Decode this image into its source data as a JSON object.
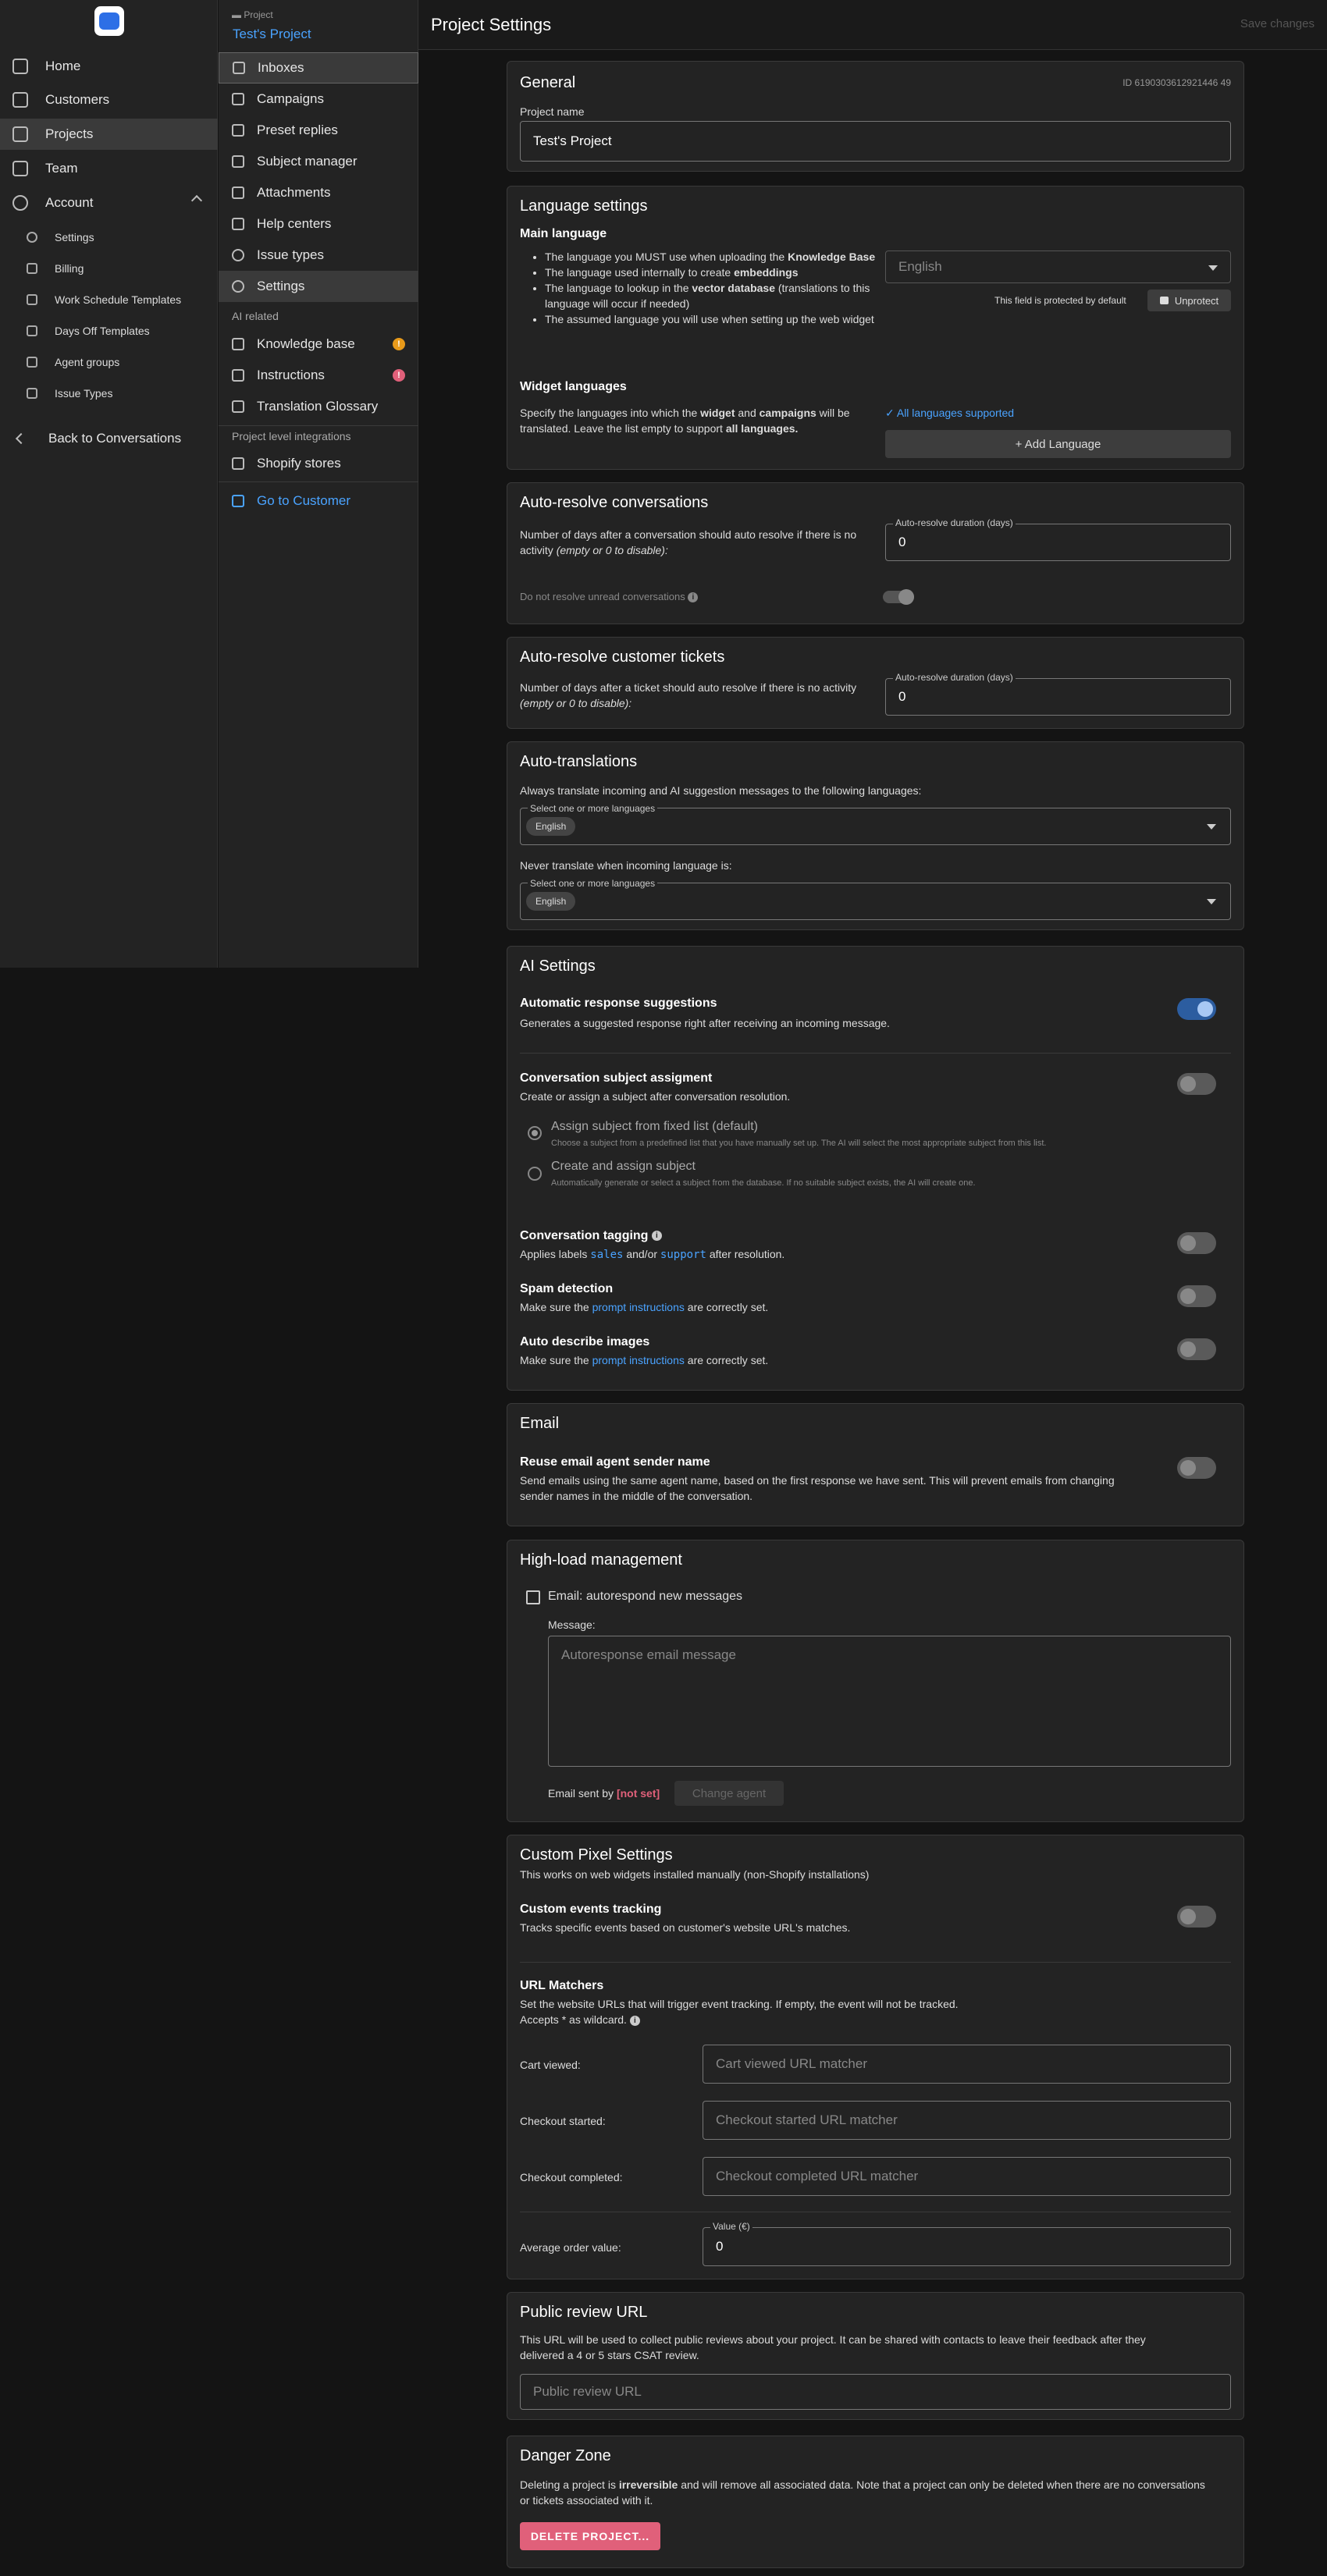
{
  "sidebar": {
    "items": [
      "Home",
      "Customers",
      "Projects",
      "Team",
      "Account"
    ],
    "account_items": [
      "Settings",
      "Billing",
      "Work Schedule Templates",
      "Days Off Templates",
      "Agent groups",
      "Issue Types"
    ],
    "back": "Back to Conversations"
  },
  "project_nav": {
    "small": "Project",
    "title": "Test's Project",
    "items": [
      "Inboxes",
      "Campaigns",
      "Preset replies",
      "Subject manager",
      "Attachments",
      "Help centers",
      "Issue types",
      "Settings"
    ],
    "ai_section": "AI related",
    "ai_items": [
      "Knowledge base",
      "Instructions",
      "Translation Glossary"
    ],
    "integ_section": "Project level integrations",
    "integ_items": [
      "Shopify stores"
    ],
    "go_customer": "Go to Customer"
  },
  "header": {
    "title": "Project Settings",
    "save": "Save changes"
  },
  "general": {
    "title": "General",
    "id": "ID 6190303612921446 49",
    "name_label": "Project name",
    "name_value": "Test's Project"
  },
  "language": {
    "title": "Language settings",
    "main": "Main language",
    "bullets": [
      "The language you MUST use when uploading the",
      "Knowledge Base",
      "The language used internally to create",
      "embeddings",
      "The language to lookup in the",
      "vector database",
      "(translations to this language will occur if needed)",
      "The assumed language you will use when setting up the web widget"
    ],
    "main_value": "English",
    "protected": "This field is protected by default",
    "unprotect": "Unprotect",
    "widget": "Widget languages",
    "widget_desc_1": "Specify the languages into which the",
    "widget_b1": "widget",
    "widget_and": "and",
    "widget_b2": "campaigns",
    "widget_desc_2": "will be translated. Leave the list empty to support",
    "widget_b3": "all languages.",
    "all_supported": "All languages supported",
    "add": "+ Add Language"
  },
  "autoresolve_conv": {
    "title": "Auto-resolve conversations",
    "desc": "Number of days after a conversation should auto resolve if there is no activity",
    "desc_i": "(empty or 0 to disable):",
    "field_label": "Auto-resolve duration (days)",
    "value": "0",
    "unread": "Do not resolve unread conversations"
  },
  "autoresolve_tickets": {
    "title": "Auto-resolve customer tickets",
    "desc": "Number of days after a ticket should auto resolve if there is no activity",
    "desc_i": "(empty or 0 to disable):",
    "field_label": "Auto-resolve duration (days)",
    "value": "0"
  },
  "autotrans": {
    "title": "Auto-translations",
    "always": "Always translate incoming and AI suggestion messages to the following languages:",
    "select_label": "Select one or more languages",
    "chip": "English",
    "never": "Never translate when incoming language is:"
  },
  "ai": {
    "title": "AI Settings",
    "auto_resp": "Automatic response suggestions",
    "auto_resp_desc": "Generates a suggested response right after receiving an incoming message.",
    "subject": "Conversation subject assigment",
    "subject_desc": "Create or assign a subject after conversation resolution.",
    "r1": "Assign subject from fixed list (default)",
    "r1_desc": "Choose a subject from a predefined list that you have manually set up. The AI will select the most appropriate subject from this list.",
    "r2": "Create and assign subject",
    "r2_desc": "Automatically generate or select a subject from the database. If no suitable subject exists, the AI will create one.",
    "tagging": "Conversation tagging",
    "tag_pre": "Applies labels",
    "tag_sales": "sales",
    "tag_and": "and/or",
    "tag_support": "support",
    "tag_post": "after resolution.",
    "spam": "Spam detection",
    "make_sure": "Make sure the",
    "prompt": "prompt instructions",
    "correct": "are correctly set.",
    "images": "Auto describe images"
  },
  "email": {
    "title": "Email",
    "reuse": "Reuse email agent sender name",
    "reuse_desc": "Send emails using the same agent name, based on the first response we have sent. This will prevent emails from changing sender names in the middle of the conversation."
  },
  "highload": {
    "title": "High-load management",
    "auto": "Email: autorespond new messages",
    "message": "Message:",
    "placeholder": "Autoresponse email message",
    "sent_by": "Email sent by",
    "not_set": "[not set]",
    "change": "Change agent"
  },
  "pixel": {
    "title": "Custom Pixel Settings",
    "sub": "This works on web widgets installed manually (non-Shopify installations)",
    "tracking": "Custom events tracking",
    "tracking_desc": "Tracks specific events based on customer's website URL's matches.",
    "matchers": "URL Matchers",
    "matchers_desc": "Set the website URLs that will trigger event tracking. If empty, the event will not be tracked.",
    "wildcard": "Accepts * as wildcard.",
    "cart": "Cart viewed:",
    "cart_ph": "Cart viewed URL matcher",
    "checkout": "Checkout started:",
    "checkout_ph": "Checkout started URL matcher",
    "completed": "Checkout completed:",
    "completed_ph": "Checkout completed URL matcher",
    "aov": "Average order value:",
    "aov_label": "Value (€)",
    "aov_value": "0"
  },
  "review": {
    "title": "Public review URL",
    "desc": "This URL will be used to collect public reviews about your project. It can be shared with contacts to leave their feedback after they delivered a 4 or 5 stars CSAT review.",
    "placeholder": "Public review URL"
  },
  "danger": {
    "title": "Danger Zone",
    "desc_1": "Deleting a project is",
    "irr": "irreversible",
    "desc_2": "and will remove all associated data. Note that a project can only be deleted when there are no conversations or tickets associated with it.",
    "btn": "DELETE PROJECT..."
  },
  "colors": {
    "accent": "#4aa3ff",
    "danger": "#e0607a",
    "warn": "#e89a1a"
  }
}
